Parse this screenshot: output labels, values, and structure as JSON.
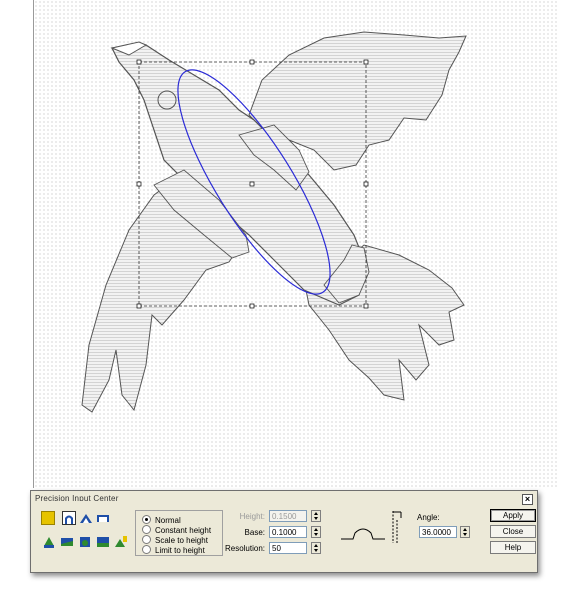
{
  "dialog": {
    "title": "Precision Input Center",
    "close_glyph": "×",
    "profile_modes": [
      {
        "label": "Normal",
        "selected": true
      },
      {
        "label": "Constant height",
        "selected": false
      },
      {
        "label": "Scale to height",
        "selected": false
      },
      {
        "label": "Limit to height",
        "selected": false
      }
    ],
    "fields": {
      "height": {
        "label": "Height:",
        "value": "0.1500",
        "enabled": false
      },
      "base": {
        "label": "Base:",
        "value": "0.1000",
        "enabled": true
      },
      "resolution": {
        "label": "Resolution:",
        "value": "50",
        "enabled": true
      },
      "angle": {
        "label": "Angle:",
        "value": "36.0000",
        "enabled": true
      }
    },
    "buttons": {
      "apply": "Apply",
      "close": "Close",
      "help": "Help"
    },
    "colors": {
      "accent_yellow": "#e6c300",
      "icon_blue": "#1f4fa8",
      "icon_green": "#2f8a2f",
      "selection_ellipse": "#2b2bd6"
    },
    "toolbar_icons": [
      "color-swatch-icon",
      "arch-profile-icon",
      "roof-profile-icon",
      "flat-profile-icon",
      "extrude-tool-icon",
      "sweep-tool-icon",
      "revolve-tool-icon",
      "layer-tool-icon",
      "paint-tool-icon"
    ]
  }
}
